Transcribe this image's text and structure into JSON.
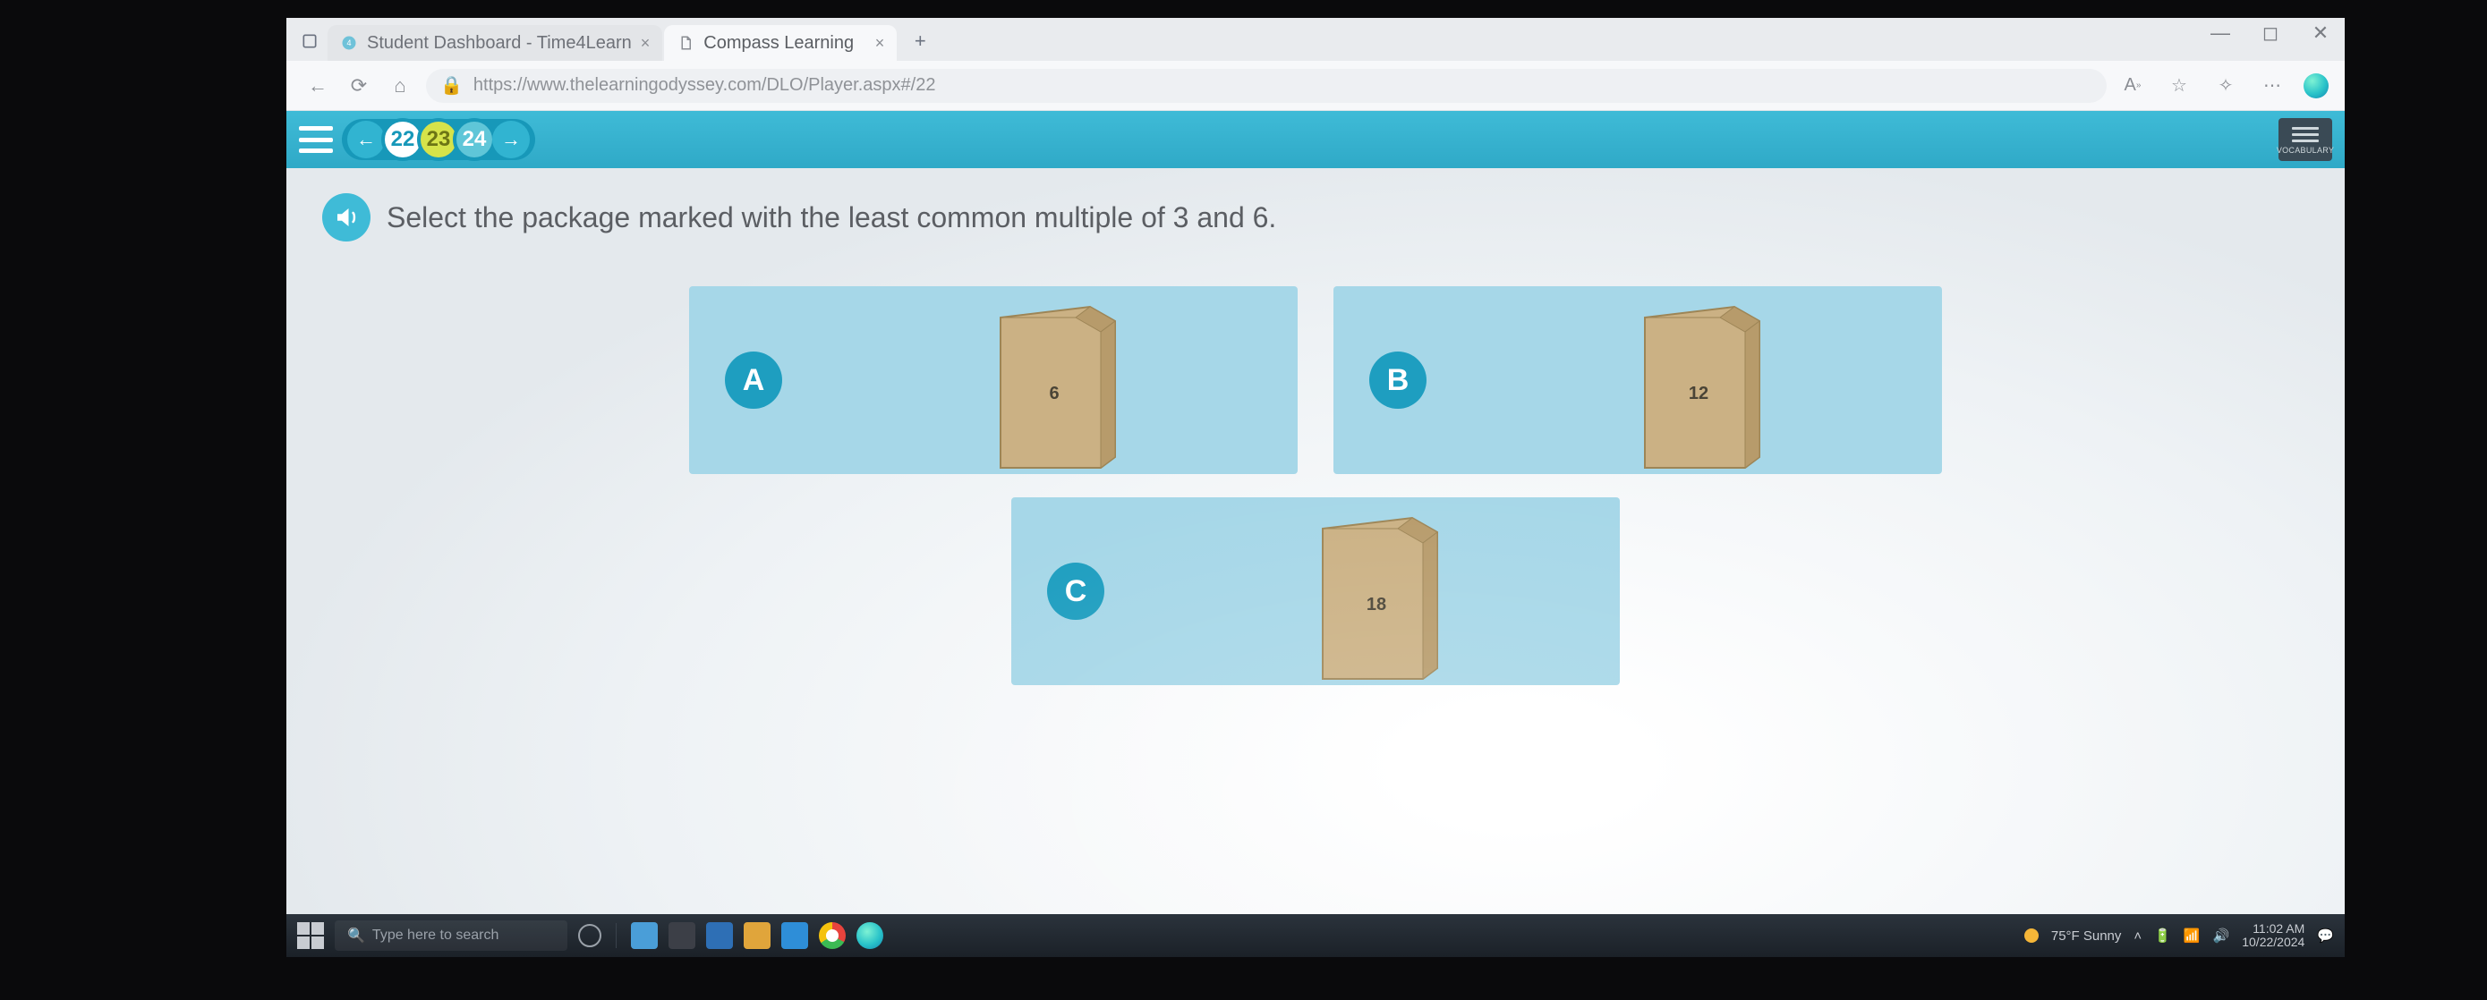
{
  "browser": {
    "tabs": [
      {
        "title": "Student Dashboard - Time4Learn",
        "active": false
      },
      {
        "title": "Compass Learning",
        "active": true
      }
    ],
    "url": "https://www.thelearningodyssey.com/DLO/Player.aspx#/22"
  },
  "appnav": {
    "steps": [
      "22",
      "23",
      "24"
    ],
    "vocab_label": "VOCABULARY"
  },
  "question": {
    "text": "Select the package marked with the least common multiple of 3 and 6."
  },
  "answers": [
    {
      "letter": "A",
      "value": "6"
    },
    {
      "letter": "B",
      "value": "12"
    },
    {
      "letter": "C",
      "value": "18"
    }
  ],
  "taskbar": {
    "search_placeholder": "Type here to search",
    "weather": "75°F  Sunny",
    "time": "11:02 AM",
    "date": "10/22/2024"
  }
}
